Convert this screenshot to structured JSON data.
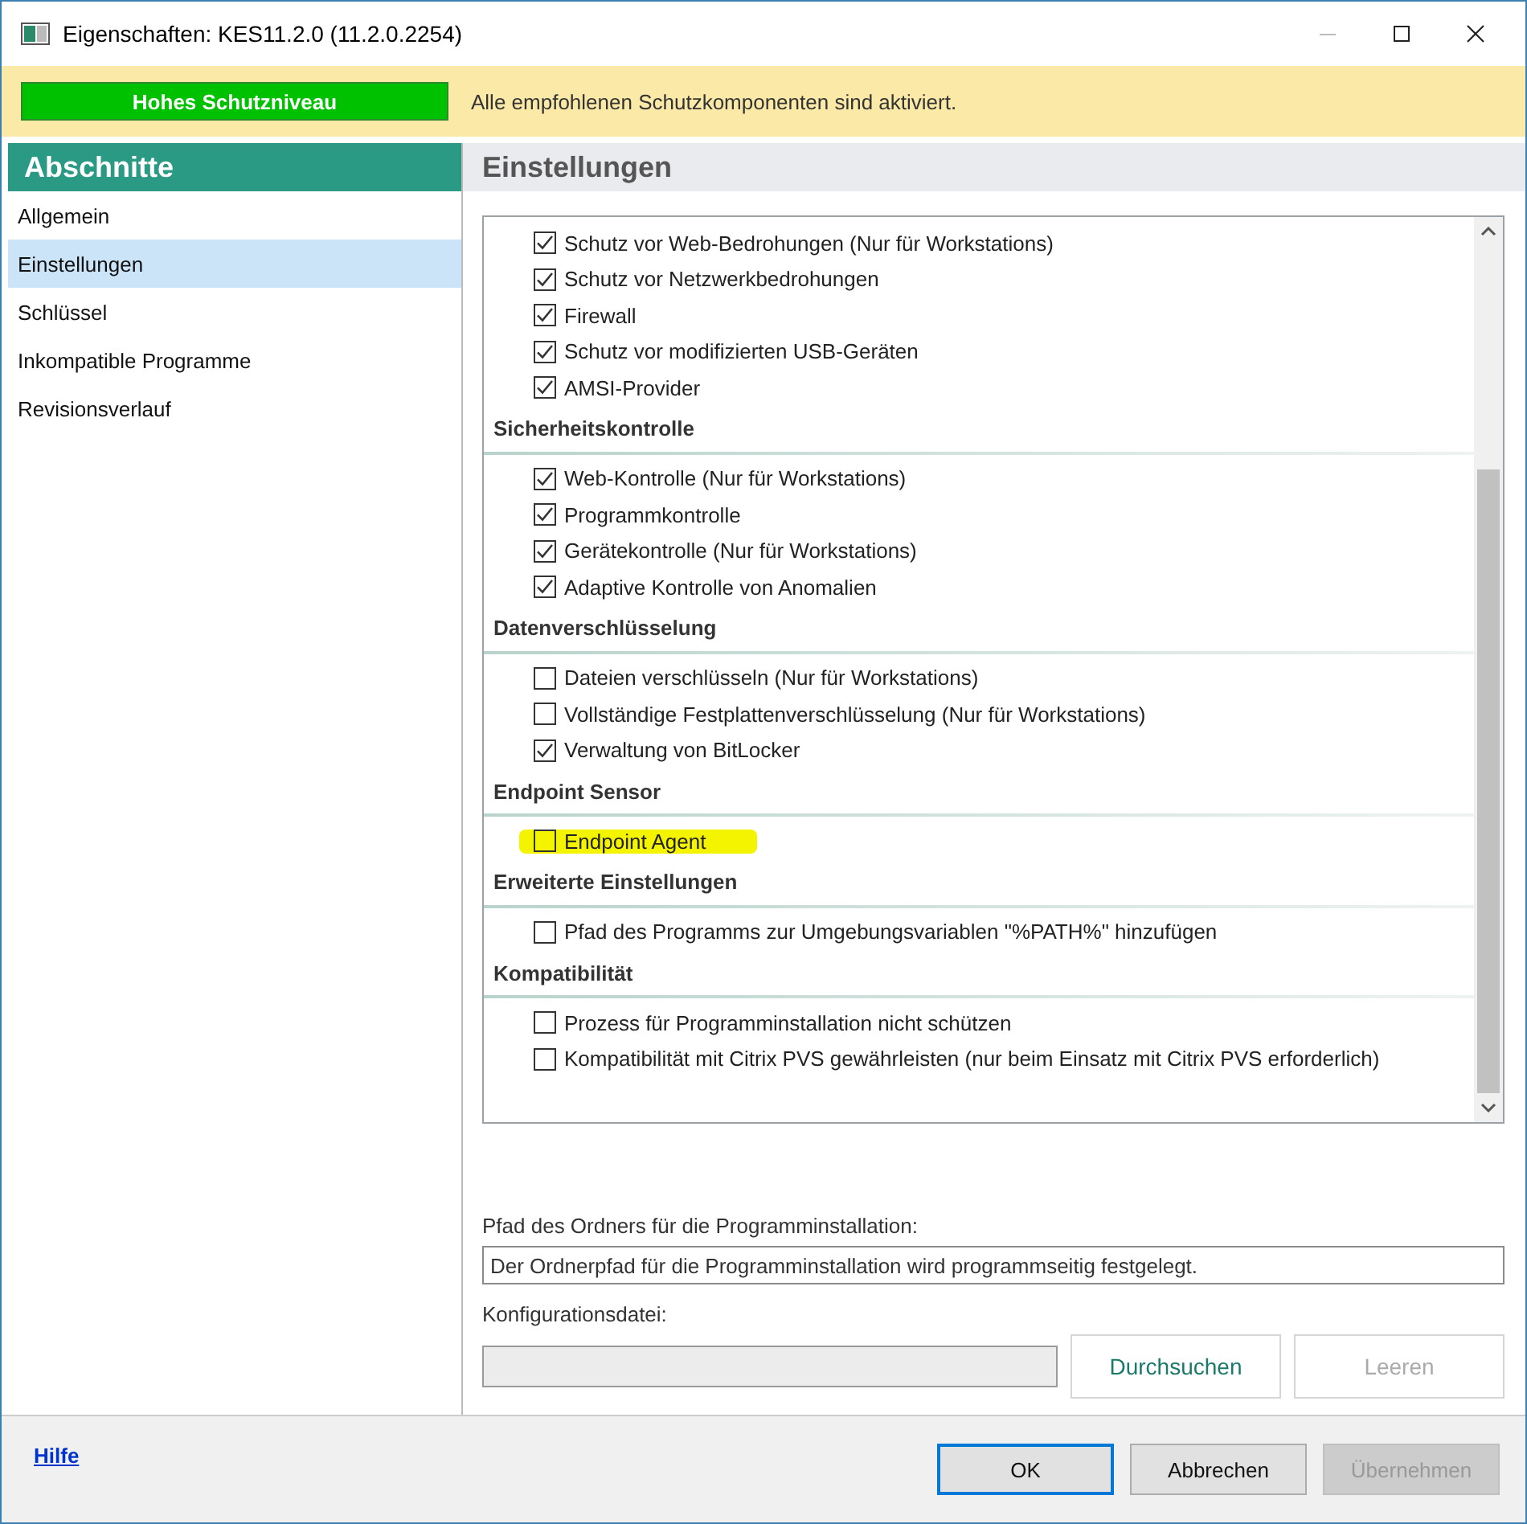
{
  "window": {
    "title": "Eigenschaften: KES11.2.0 (11.2.0.2254)"
  },
  "status": {
    "badge": "Hohes Schutzniveau",
    "message": "Alle empfohlenen Schutzkomponenten sind aktiviert."
  },
  "sidebar": {
    "title": "Abschnitte",
    "items": [
      {
        "label": "Allgemein",
        "selected": false
      },
      {
        "label": "Einstellungen",
        "selected": true
      },
      {
        "label": "Schlüssel",
        "selected": false
      },
      {
        "label": "Inkompatible Programme",
        "selected": false
      },
      {
        "label": "Revisionsverlauf",
        "selected": false
      }
    ]
  },
  "panel": {
    "title": "Einstellungen",
    "groups": [
      {
        "items": [
          {
            "label": "Schutz vor Web-Bedrohungen (Nur für Workstations)",
            "checked": true,
            "highlighted": false
          },
          {
            "label": "Schutz vor Netzwerkbedrohungen",
            "checked": true,
            "highlighted": false
          },
          {
            "label": "Firewall",
            "checked": true,
            "highlighted": false
          },
          {
            "label": "Schutz vor modifizierten USB-Geräten",
            "checked": true,
            "highlighted": false
          },
          {
            "label": "AMSI-Provider",
            "checked": true,
            "highlighted": false
          }
        ]
      },
      {
        "heading": "Sicherheitskontrolle",
        "items": [
          {
            "label": "Web-Kontrolle (Nur für Workstations)",
            "checked": true,
            "highlighted": false
          },
          {
            "label": "Programmkontrolle",
            "checked": true,
            "highlighted": false
          },
          {
            "label": "Gerätekontrolle (Nur für Workstations)",
            "checked": true,
            "highlighted": false
          },
          {
            "label": "Adaptive Kontrolle von Anomalien",
            "checked": true,
            "highlighted": false
          }
        ]
      },
      {
        "heading": "Datenverschlüsselung",
        "items": [
          {
            "label": "Dateien verschlüsseln (Nur für Workstations)",
            "checked": false,
            "highlighted": false
          },
          {
            "label": "Vollständige Festplattenverschlüsselung (Nur für Workstations)",
            "checked": false,
            "highlighted": false
          },
          {
            "label": "Verwaltung von BitLocker",
            "checked": true,
            "highlighted": false
          }
        ]
      },
      {
        "heading": "Endpoint Sensor",
        "items": [
          {
            "label": "Endpoint Agent",
            "checked": false,
            "highlighted": true
          }
        ]
      },
      {
        "heading": "Erweiterte Einstellungen",
        "items": [
          {
            "label": "Pfad des Programms zur Umgebungsvariablen \"%PATH%\" hinzufügen",
            "checked": false,
            "highlighted": false
          }
        ]
      },
      {
        "heading": "Kompatibilität",
        "items": [
          {
            "label": "Prozess für Programminstallation nicht schützen",
            "checked": false,
            "highlighted": false
          },
          {
            "label": "Kompatibilität mit Citrix PVS gewährleisten (nur beim Einsatz mit Citrix PVS erforderlich)",
            "checked": false,
            "highlighted": false
          }
        ]
      }
    ],
    "install_path": {
      "label": "Pfad des Ordners für die Programminstallation:",
      "value": "Der Ordnerpfad für die Programminstallation wird programmseitig festgelegt."
    },
    "config_file": {
      "label": "Konfigurationsdatei:",
      "buttons": [
        {
          "label": "Durchsuchen",
          "disabled": false
        },
        {
          "label": "Leeren",
          "disabled": true
        }
      ]
    }
  },
  "footer": {
    "help": "Hilfe",
    "buttons": [
      {
        "label": "OK",
        "default": true,
        "disabled": false
      },
      {
        "label": "Abbrechen",
        "default": false,
        "disabled": false
      },
      {
        "label": "Übernehmen",
        "default": false,
        "disabled": true
      }
    ]
  }
}
